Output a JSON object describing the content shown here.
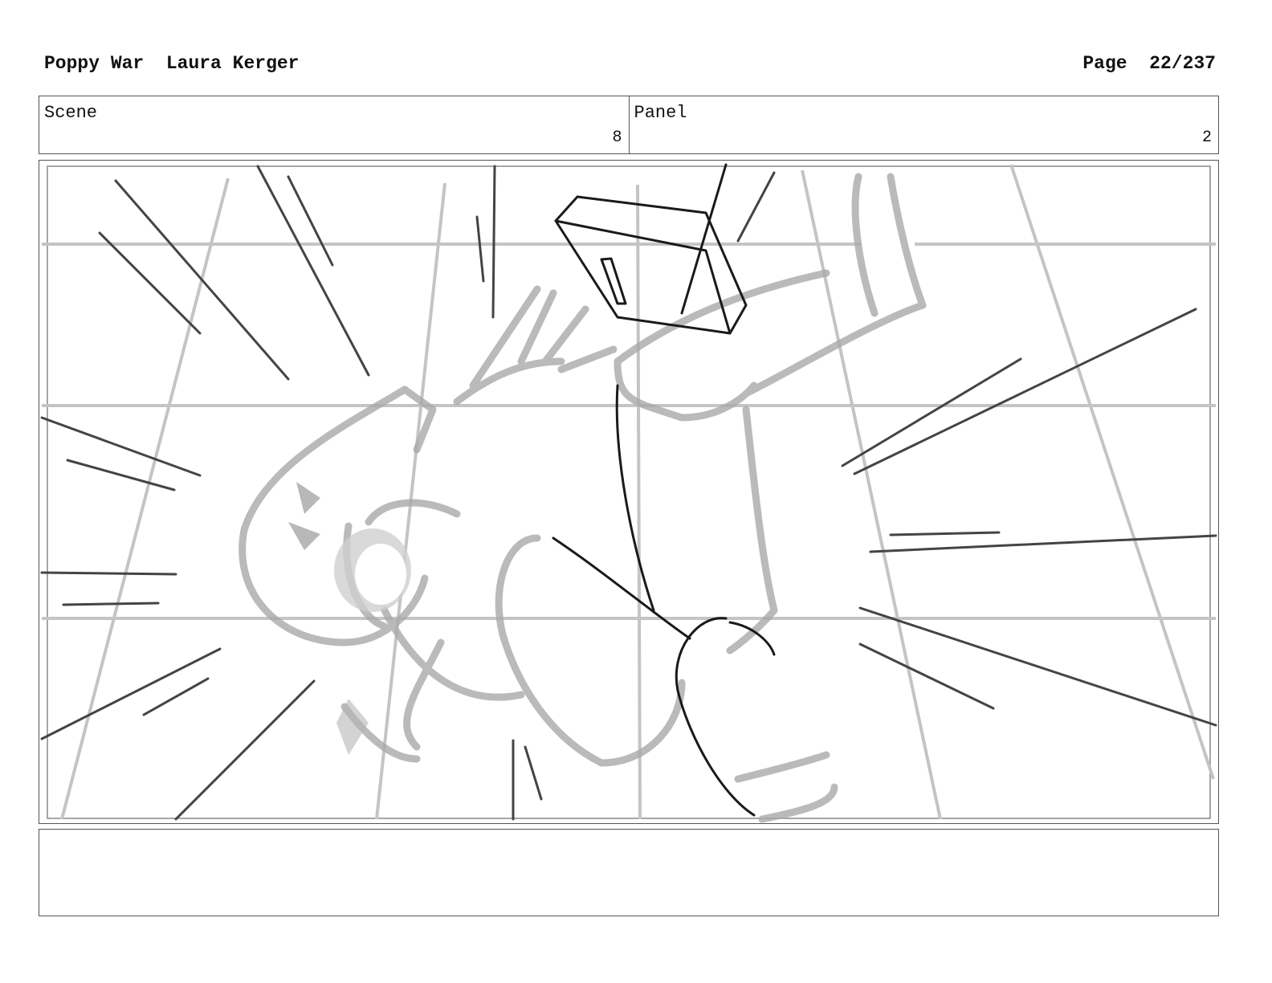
{
  "header": {
    "title": "Poppy War",
    "author": "Laura Kerger",
    "page_label": "Page",
    "page_number": "22/237"
  },
  "meta": {
    "scene_label": "Scene",
    "scene_value": "8",
    "panel_label": "Panel",
    "panel_value": "2"
  },
  "notes": {
    "text": ""
  }
}
